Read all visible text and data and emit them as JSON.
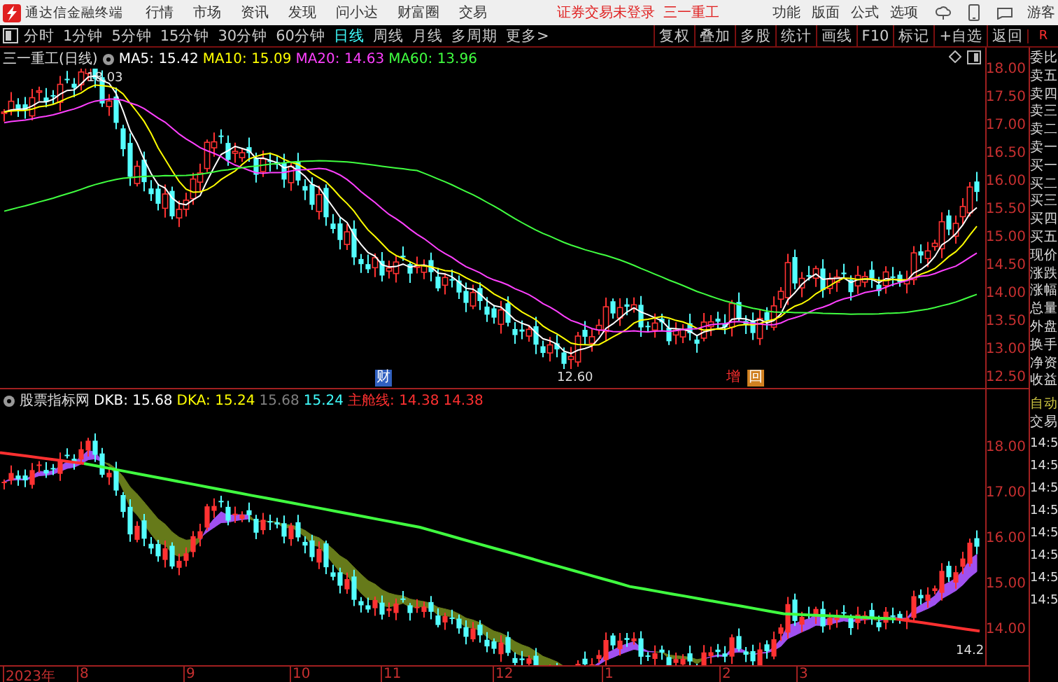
{
  "menu_bar": {
    "app_title": "通达信金融终端",
    "menus": [
      "行情",
      "市场",
      "资讯",
      "发现",
      "问小达",
      "财富圈",
      "交易"
    ],
    "login_notice": "证券交易未登录",
    "stock_name": "三一重工",
    "right_menus": [
      "功能",
      "版面",
      "公式",
      "选项"
    ],
    "user": "游客"
  },
  "period_tabs": [
    {
      "label": "分时",
      "selected": false
    },
    {
      "label": "1分钟",
      "selected": false
    },
    {
      "label": "5分钟",
      "selected": false
    },
    {
      "label": "15分钟",
      "selected": false
    },
    {
      "label": "30分钟",
      "selected": false
    },
    {
      "label": "60分钟",
      "selected": false
    },
    {
      "label": "日线",
      "selected": true
    },
    {
      "label": "周线",
      "selected": false
    },
    {
      "label": "月线",
      "selected": false
    },
    {
      "label": "多周期",
      "selected": false
    },
    {
      "label": "更多>",
      "selected": false
    }
  ],
  "tool_buttons": [
    "复权",
    "叠加",
    "多股",
    "统计",
    "画线",
    "F10",
    "标记",
    "+自选",
    "返回"
  ],
  "panel_badge": "R",
  "main_chart": {
    "title": "三一重工(日线)",
    "legend": [
      {
        "label": "MA5: 15.42",
        "color": "#ffffff"
      },
      {
        "label": "MA10: 15.09",
        "color": "#ffff00"
      },
      {
        "label": "MA20: 14.63",
        "color": "#ff40ff"
      },
      {
        "label": "MA60: 13.96",
        "color": "#40ff40"
      }
    ],
    "high_label": "18.03",
    "low_label": "12.60",
    "event_marks": [
      {
        "text": "财",
        "color": "#3060c0"
      },
      {
        "text": "增",
        "color": "#ff3030"
      },
      {
        "text": "回",
        "color": "#d08020"
      }
    ],
    "y_ticks": [
      "18.00",
      "17.50",
      "17.00",
      "16.50",
      "16.00",
      "15.50",
      "15.00",
      "14.50",
      "14.00",
      "13.50",
      "13.00",
      "12.50"
    ]
  },
  "indicator_chart": {
    "title": "股票指标网",
    "legend": [
      {
        "label": "DKB: 15.68",
        "color": "#ffffff"
      },
      {
        "label": "DKA: 15.24",
        "color": "#ffff00"
      },
      {
        "label": "15.68",
        "color": "#808080"
      },
      {
        "label": "15.24",
        "color": "#40ffff"
      },
      {
        "label": "主舱线: 14.38",
        "color": "#ff3030"
      },
      {
        "label": "14.38",
        "color": "#ff3030"
      }
    ],
    "end_label": "14.2",
    "y_ticks": [
      "18.00",
      "17.00",
      "16.00",
      "15.00",
      "14.00"
    ]
  },
  "quote_panel": {
    "labels": [
      "委比",
      "卖五",
      "卖四",
      "卖三",
      "卖二",
      "卖一",
      "买一",
      "买二",
      "买三",
      "买四",
      "买五",
      "现价",
      "涨跌",
      "涨幅",
      "总量",
      "外盘",
      "换手",
      "净资",
      "收益"
    ],
    "mode": "自动",
    "trade_header": "交易",
    "trade_times": [
      "14:5",
      "14:5",
      "14:5",
      "14:5",
      "14:5",
      "14:5",
      "14:5",
      "14:5"
    ]
  },
  "time_axis": [
    "2023年",
    "8",
    "9",
    "10",
    "11",
    "12",
    "1",
    "2",
    "3"
  ]
}
